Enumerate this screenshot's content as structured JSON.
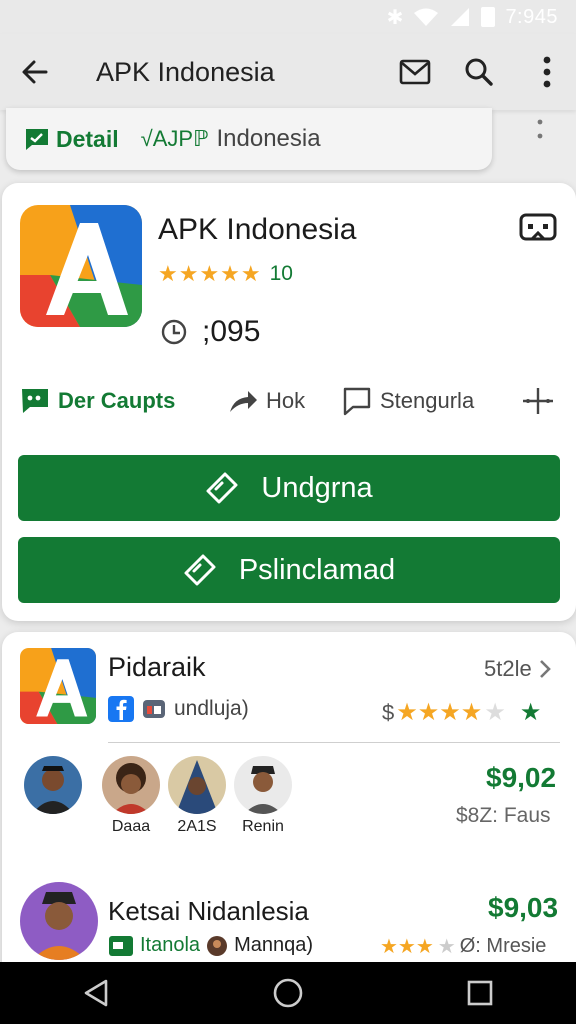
{
  "status_bar": {
    "time": "7:945"
  },
  "app_bar": {
    "title": "APK Indonesia"
  },
  "detail_strip": {
    "tab_detail": "Detail",
    "tab_sub": "√AJPℙ",
    "tab_sub2": "Indonesia"
  },
  "app_card": {
    "title": "APK Indonesia",
    "stars": "★★★★★",
    "rating": "10",
    "installs": ";095",
    "actions": [
      {
        "label": "Der Caupts",
        "icon": "message-icon"
      },
      {
        "label": "Hok",
        "icon": "share-icon"
      },
      {
        "label": "Stengurla",
        "icon": "comment-icon"
      }
    ],
    "buttons": [
      {
        "label": "Undgrna",
        "icon": "tag-icon"
      },
      {
        "label": "Pslinclamad",
        "icon": "tag-icon"
      }
    ]
  },
  "list": {
    "item1": {
      "title": "Pidaraik",
      "size": "5t2le",
      "sub": "undluja)",
      "currency": "$",
      "stars": "★★★★",
      "star_empty": "★",
      "star_green": "★",
      "avatars": [
        {
          "name": "Daaa"
        },
        {
          "name": "2A1S"
        },
        {
          "name": "Renin"
        }
      ],
      "price": "$9,02",
      "price_sub": "$8Z: Faus"
    },
    "item2": {
      "title": "Ketsai Nidanlesia",
      "price": "$9,03",
      "tag": "Itanola",
      "tag2": "Mannqa)",
      "stars": "★★★",
      "star_empty": "★",
      "extra": "Ø: Mresie"
    }
  },
  "colors": {
    "primary_green": "#137a34",
    "star": "#f5a623"
  }
}
